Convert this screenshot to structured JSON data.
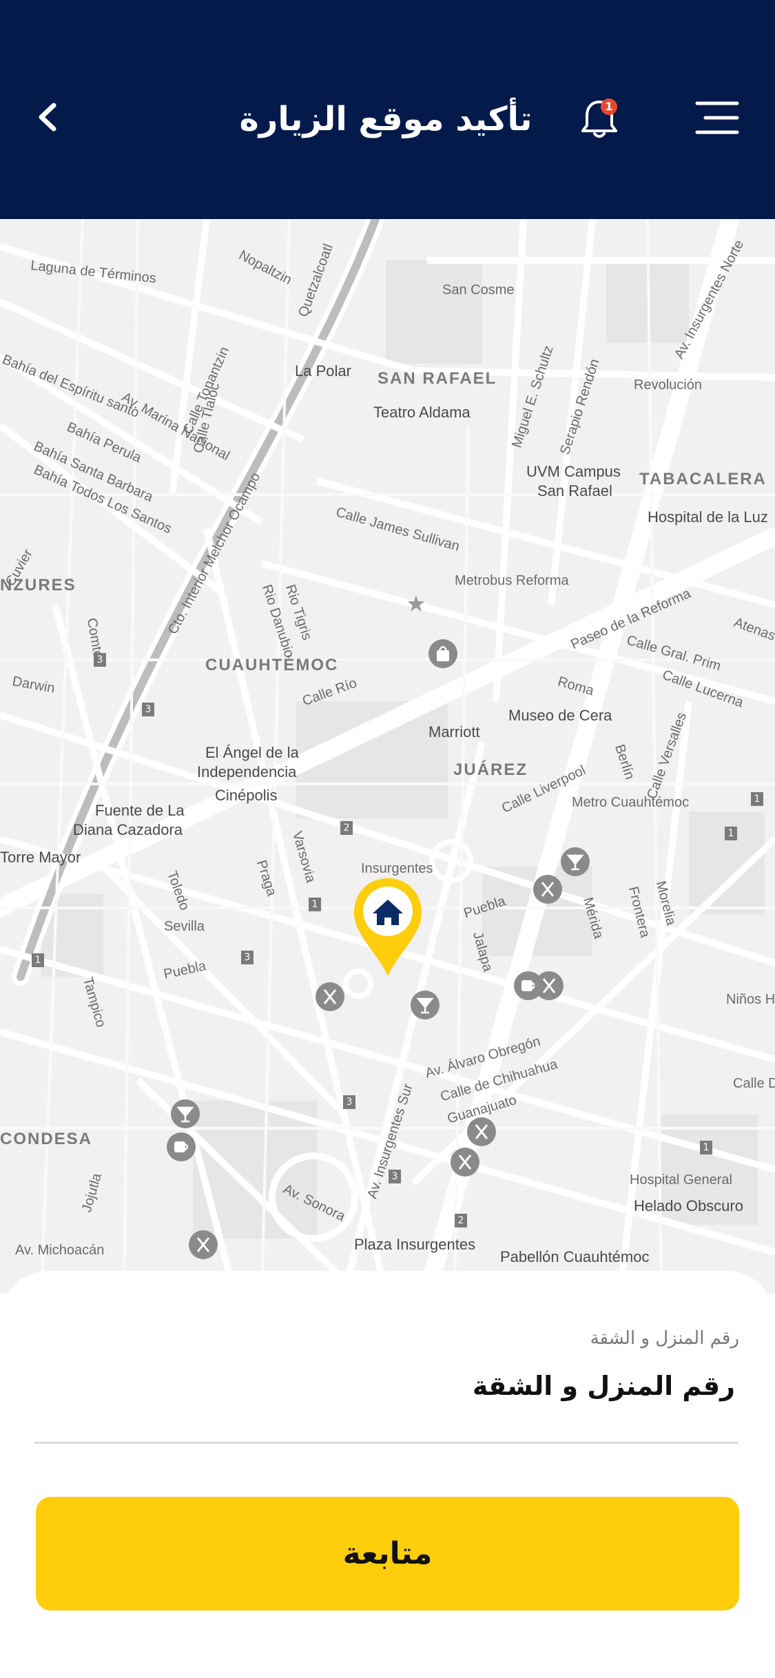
{
  "header": {
    "title": "تأكيد موقع الزيارة",
    "notification_count": "1",
    "background": "#031a4a"
  },
  "icons": {
    "back": "chevron-left-icon",
    "notifications": "bell-icon",
    "menu": "menu-icon",
    "marker": "home-pin-icon"
  },
  "map": {
    "labels": [
      "Laguna de Términos",
      "Nopaltzin",
      "Quetzalcoatl",
      "San Cosme",
      "La Polar",
      "SAN RAFAEL",
      "Teatro Aldama",
      "Miguel E. Schultz",
      "Serapio Rendón",
      "Revolución",
      "Av. Insurgentes Norte",
      "Bahía del Espíritu santo",
      "Bahía Perula",
      "Bahía Santa Barbara",
      "Bahía Todos Los Santos",
      "Av. Marina Nacional",
      "Calle Tlaloc",
      "Calle Tonantzin",
      "UVM Campus",
      "San Rafael",
      "TABACALERA",
      "Hospital de la Luz",
      "Calle James Sullivan",
      "Metrobus Reforma",
      "Cto. Interior Melchor Ocampo",
      "NZURES",
      "Cuvier",
      "Comte",
      "Darwin",
      "Rio Danubio",
      "Rio Tigris",
      "CUAUHTÉMOC",
      "Calle Río",
      "Paseo de la Reforma",
      "Atenas",
      "Calle Gral. Prim",
      "Roma",
      "Calle Lucerna",
      "Museo de Cera",
      "Marriott",
      "El Ángel de la",
      "Independencia",
      "JUÁREZ",
      "Calle Liverpool",
      "Berlín",
      "Calle Versalles",
      "Cinépolis",
      "Fuente de La",
      "Diana Cazadora",
      "Metro Cuauhtémoc",
      "Torre Mayor",
      "Varsovia",
      "Praga",
      "Toledo",
      "Insurgentes",
      "Puebla",
      "Jalapa",
      "Mérida",
      "Frontera",
      "Morelia",
      "Sevilla",
      "Puebla",
      "Tampico",
      "Niños H",
      "Calle D",
      "Av. Álvaro Obregón",
      "Calle de Chihuahua",
      "Guanajuato",
      "Av. Insurgentes Sur",
      "CONDESA",
      "Jojutla",
      "Av. Sonora",
      "Hospital General",
      "Helado Obscuro",
      "Av. Michoacán",
      "Plaza Insurgentes",
      "Pabellón Cuauhtémoc"
    ],
    "badges": [
      "3",
      "3",
      "2",
      "1",
      "3",
      "1",
      "3",
      "3",
      "2",
      "1",
      "1",
      "1"
    ]
  },
  "form": {
    "caption": "رقم المنزل و الشقة",
    "value": "رقم المنزل و الشقة"
  },
  "actions": {
    "continue_label": "متابعة",
    "accent": "#fecd0b"
  }
}
